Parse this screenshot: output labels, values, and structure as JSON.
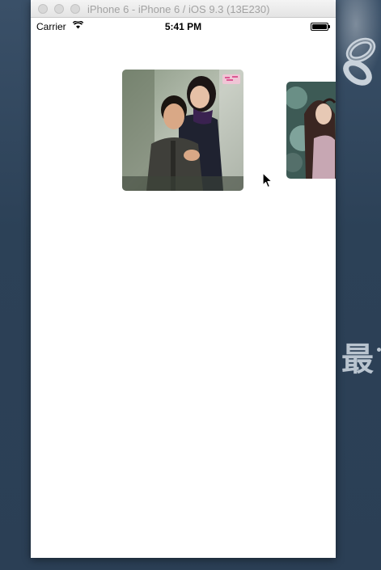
{
  "window": {
    "title": "iPhone 6 - iPhone 6 / iOS 9.3 (13E230)"
  },
  "status_bar": {
    "carrier": "Carrier",
    "time": "5:41 PM",
    "wifi_icon": "wifi-icon",
    "battery_icon": "battery-icon",
    "battery_level": 1.0
  },
  "carousel": {
    "selected_index": 0,
    "cards": [
      {
        "subject": "couple-photo",
        "watermark_icon": "pink-logo-icon"
      },
      {
        "subject": "girl-portrait-photo"
      }
    ]
  },
  "wallpaper": {
    "text": "最"
  },
  "colors": {
    "wallpaper": "#2c4157",
    "titlebar": "#e8e8e8",
    "screen": "#ffffff"
  }
}
